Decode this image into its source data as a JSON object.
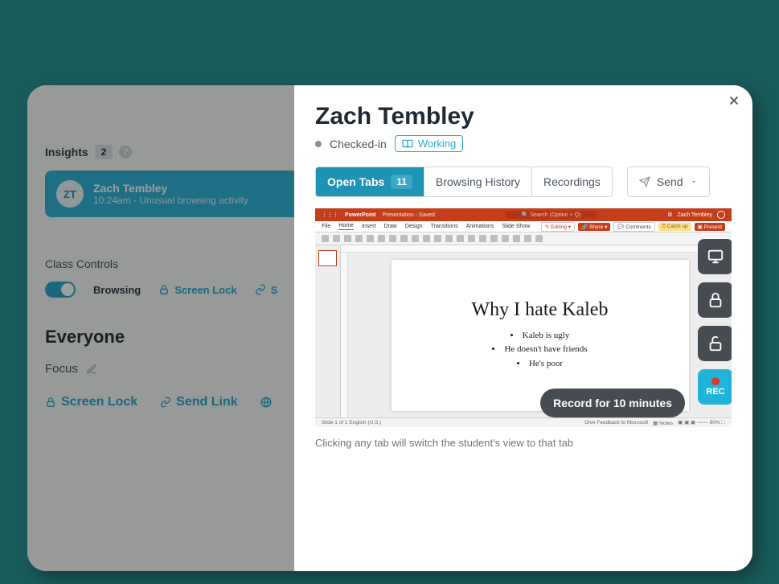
{
  "background": {
    "insights_label": "Insights",
    "insights_count": "2",
    "card": {
      "initials": "ZT",
      "name": "Zach Tembley",
      "subtitle": "10:24am - Unusual browsing activity"
    },
    "class_controls_label": "Class Controls",
    "browsing_label": "Browsing",
    "screen_lock_label": "Screen Lock",
    "s_label": "S",
    "everyone_label": "Everyone",
    "focus_label": "Focus",
    "bottom_screen_lock": "Screen Lock",
    "bottom_send_link": "Send Link"
  },
  "panel": {
    "student_name": "Zach Tembley",
    "checked_in": "Checked-in",
    "working_badge": "Working",
    "tabs": {
      "open_tabs": "Open Tabs",
      "open_tabs_count": "11",
      "browsing_history": "Browsing History",
      "recordings": "Recordings"
    },
    "send_label": "Send",
    "record_tooltip": "Record for 10 minutes",
    "rec_label": "REC",
    "hint": "Clicking any tab will switch the student's view to that tab"
  },
  "powerpoint": {
    "app_name": "PowerPoint",
    "doc_status": "Presentation - Saved ",
    "search_placeholder": "Search (Option + Q)",
    "user_name": "Zach Tembley",
    "ribbon": {
      "file": "File",
      "home": "Home",
      "insert": "Insert",
      "draw": "Draw",
      "design": "Design",
      "transitions": "Transitions",
      "animations": "Animations",
      "slideshow": "Slide Show",
      "editing": "Editing",
      "share": "Share",
      "comments": "Comments",
      "catchup": "Catch up",
      "present": "Present"
    },
    "slide": {
      "title": "Why I hate Kaleb",
      "b1": "Kaleb is ugly",
      "b2": "He doesn't have friends",
      "b3": "He's poor"
    },
    "status": {
      "left": "Slide 1 of 1    English (U.S.)",
      "feedback": "Give Feedback to Microsoft",
      "notes": "Notes",
      "zoom": "80%"
    }
  }
}
